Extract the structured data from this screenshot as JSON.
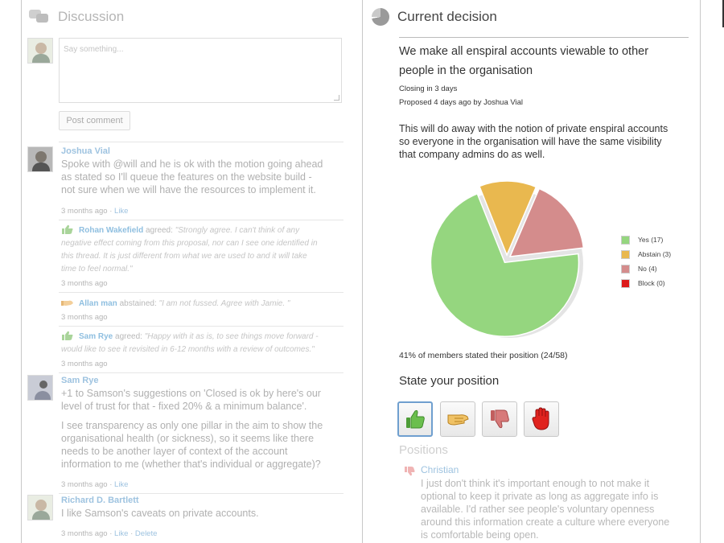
{
  "discussion": {
    "title": "Discussion",
    "textarea_placeholder": "Say something...",
    "post_button": "Post comment",
    "comments": [
      {
        "author": "Joshua Vial",
        "lines": [
          "Spoke with @will and he is ok with the motion going ahead",
          "as stated so I'll queue the features on the website build -",
          "not sure when we will have the resources to implement it."
        ],
        "time": "3 months ago",
        "sep": " · ",
        "like": "Like"
      },
      {
        "author": "Sam Rye",
        "lines": [
          "+1 to Samson's suggestions on 'Closed is ok by here's our",
          "level of trust for that - fixed 20% & a minimum balance'.",
          "",
          "I see transparency as only one pillar in the aim to show the",
          "organisational health (or sickness), so it seems like there",
          "needs to be another layer of context of the account",
          "information to me (whether that's individual or aggregate)?"
        ],
        "time": "3 months ago",
        "sep": " · ",
        "like": "Like"
      },
      {
        "author": "Richard D. Bartlett",
        "lines": [
          "I like Samson's caveats on private accounts."
        ],
        "time": "3 months ago",
        "sep": " · ",
        "like": "Like",
        "sep2": " · ",
        "delete": "Delete"
      }
    ],
    "votes": [
      {
        "name": "Rohan Wakefield",
        "action": "agreed:",
        "lines": [
          "\"Strongly agree. I can't think of any",
          "negative effect coming from this proposal, nor can I see one identified in",
          "this thread. It is just different from what we are used to and it will take",
          "time to feel normal.\""
        ],
        "time": "3 months ago"
      },
      {
        "name": "Allan man",
        "action": "abstained:",
        "lines": [
          "\"I am not fussed. Agree with Jamie. \""
        ],
        "time": "3 months ago"
      },
      {
        "name": "Sam Rye",
        "action": "agreed:",
        "lines": [
          "\"Happy with it as is, to see things move forward -",
          "would like to see it revisited in 6-12 months with a review of outcomes.\""
        ],
        "time": "3 months ago"
      }
    ]
  },
  "decision": {
    "title": "Current decision",
    "proposal_lines": [
      "We make all enspiral accounts viewable to other",
      "people in the organisation"
    ],
    "closing": "Closing in 3 days",
    "proposed": "Proposed 4 days ago by Joshua Vial",
    "description_lines": [
      "This will do away with the notion of private enspiral accounts",
      "so everyone in the organisation will have the same visibility",
      "that company admins do as well."
    ],
    "stated": "41% of members stated their position (24/58)",
    "state_title": "State your position",
    "positions_title": "Positions",
    "position_author": "Christian",
    "position_lines": [
      "I just don't think it's important enough to not make it",
      "optional to keep it private as long as aggregate info is",
      "available. I'd rather see people's voluntary openness",
      "around this information create a culture where everyone",
      "is comfortable being open."
    ]
  },
  "chart_data": {
    "type": "pie",
    "categories": [
      "Yes",
      "Abstain",
      "No",
      "Block"
    ],
    "values": [
      17,
      3,
      4,
      0
    ],
    "legend": [
      "Yes (17)",
      "Abstain (3)",
      "No (4)",
      "Block (0)"
    ],
    "colors": [
      "#95d67f",
      "#e9b84f",
      "#d48c8c",
      "#dd1a1a"
    ],
    "legend_position": "right"
  },
  "position_buttons": [
    {
      "icon": "thumbs-up-icon",
      "color": "#6bbf4e"
    },
    {
      "icon": "hand-sideways-icon",
      "color": "#e6a93a"
    },
    {
      "icon": "thumbs-down-icon",
      "color": "#d77a7a"
    },
    {
      "icon": "stop-hand-icon",
      "color": "#e0231e"
    }
  ]
}
